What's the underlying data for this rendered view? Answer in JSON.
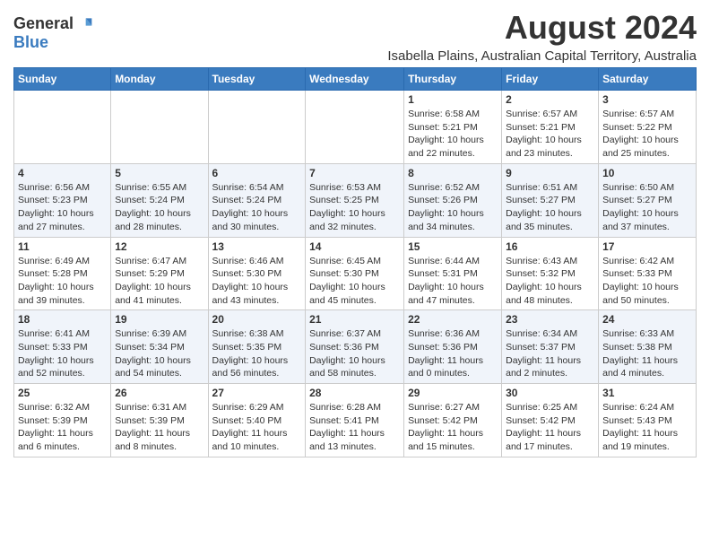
{
  "logo": {
    "general": "General",
    "blue": "Blue"
  },
  "title": "August 2024",
  "subtitle": "Isabella Plains, Australian Capital Territory, Australia",
  "headers": [
    "Sunday",
    "Monday",
    "Tuesday",
    "Wednesday",
    "Thursday",
    "Friday",
    "Saturday"
  ],
  "weeks": [
    [
      {
        "day": "",
        "info": ""
      },
      {
        "day": "",
        "info": ""
      },
      {
        "day": "",
        "info": ""
      },
      {
        "day": "",
        "info": ""
      },
      {
        "day": "1",
        "info": "Sunrise: 6:58 AM\nSunset: 5:21 PM\nDaylight: 10 hours\nand 22 minutes."
      },
      {
        "day": "2",
        "info": "Sunrise: 6:57 AM\nSunset: 5:21 PM\nDaylight: 10 hours\nand 23 minutes."
      },
      {
        "day": "3",
        "info": "Sunrise: 6:57 AM\nSunset: 5:22 PM\nDaylight: 10 hours\nand 25 minutes."
      }
    ],
    [
      {
        "day": "4",
        "info": "Sunrise: 6:56 AM\nSunset: 5:23 PM\nDaylight: 10 hours\nand 27 minutes."
      },
      {
        "day": "5",
        "info": "Sunrise: 6:55 AM\nSunset: 5:24 PM\nDaylight: 10 hours\nand 28 minutes."
      },
      {
        "day": "6",
        "info": "Sunrise: 6:54 AM\nSunset: 5:24 PM\nDaylight: 10 hours\nand 30 minutes."
      },
      {
        "day": "7",
        "info": "Sunrise: 6:53 AM\nSunset: 5:25 PM\nDaylight: 10 hours\nand 32 minutes."
      },
      {
        "day": "8",
        "info": "Sunrise: 6:52 AM\nSunset: 5:26 PM\nDaylight: 10 hours\nand 34 minutes."
      },
      {
        "day": "9",
        "info": "Sunrise: 6:51 AM\nSunset: 5:27 PM\nDaylight: 10 hours\nand 35 minutes."
      },
      {
        "day": "10",
        "info": "Sunrise: 6:50 AM\nSunset: 5:27 PM\nDaylight: 10 hours\nand 37 minutes."
      }
    ],
    [
      {
        "day": "11",
        "info": "Sunrise: 6:49 AM\nSunset: 5:28 PM\nDaylight: 10 hours\nand 39 minutes."
      },
      {
        "day": "12",
        "info": "Sunrise: 6:47 AM\nSunset: 5:29 PM\nDaylight: 10 hours\nand 41 minutes."
      },
      {
        "day": "13",
        "info": "Sunrise: 6:46 AM\nSunset: 5:30 PM\nDaylight: 10 hours\nand 43 minutes."
      },
      {
        "day": "14",
        "info": "Sunrise: 6:45 AM\nSunset: 5:30 PM\nDaylight: 10 hours\nand 45 minutes."
      },
      {
        "day": "15",
        "info": "Sunrise: 6:44 AM\nSunset: 5:31 PM\nDaylight: 10 hours\nand 47 minutes."
      },
      {
        "day": "16",
        "info": "Sunrise: 6:43 AM\nSunset: 5:32 PM\nDaylight: 10 hours\nand 48 minutes."
      },
      {
        "day": "17",
        "info": "Sunrise: 6:42 AM\nSunset: 5:33 PM\nDaylight: 10 hours\nand 50 minutes."
      }
    ],
    [
      {
        "day": "18",
        "info": "Sunrise: 6:41 AM\nSunset: 5:33 PM\nDaylight: 10 hours\nand 52 minutes."
      },
      {
        "day": "19",
        "info": "Sunrise: 6:39 AM\nSunset: 5:34 PM\nDaylight: 10 hours\nand 54 minutes."
      },
      {
        "day": "20",
        "info": "Sunrise: 6:38 AM\nSunset: 5:35 PM\nDaylight: 10 hours\nand 56 minutes."
      },
      {
        "day": "21",
        "info": "Sunrise: 6:37 AM\nSunset: 5:36 PM\nDaylight: 10 hours\nand 58 minutes."
      },
      {
        "day": "22",
        "info": "Sunrise: 6:36 AM\nSunset: 5:36 PM\nDaylight: 11 hours\nand 0 minutes."
      },
      {
        "day": "23",
        "info": "Sunrise: 6:34 AM\nSunset: 5:37 PM\nDaylight: 11 hours\nand 2 minutes."
      },
      {
        "day": "24",
        "info": "Sunrise: 6:33 AM\nSunset: 5:38 PM\nDaylight: 11 hours\nand 4 minutes."
      }
    ],
    [
      {
        "day": "25",
        "info": "Sunrise: 6:32 AM\nSunset: 5:39 PM\nDaylight: 11 hours\nand 6 minutes."
      },
      {
        "day": "26",
        "info": "Sunrise: 6:31 AM\nSunset: 5:39 PM\nDaylight: 11 hours\nand 8 minutes."
      },
      {
        "day": "27",
        "info": "Sunrise: 6:29 AM\nSunset: 5:40 PM\nDaylight: 11 hours\nand 10 minutes."
      },
      {
        "day": "28",
        "info": "Sunrise: 6:28 AM\nSunset: 5:41 PM\nDaylight: 11 hours\nand 13 minutes."
      },
      {
        "day": "29",
        "info": "Sunrise: 6:27 AM\nSunset: 5:42 PM\nDaylight: 11 hours\nand 15 minutes."
      },
      {
        "day": "30",
        "info": "Sunrise: 6:25 AM\nSunset: 5:42 PM\nDaylight: 11 hours\nand 17 minutes."
      },
      {
        "day": "31",
        "info": "Sunrise: 6:24 AM\nSunset: 5:43 PM\nDaylight: 11 hours\nand 19 minutes."
      }
    ]
  ]
}
